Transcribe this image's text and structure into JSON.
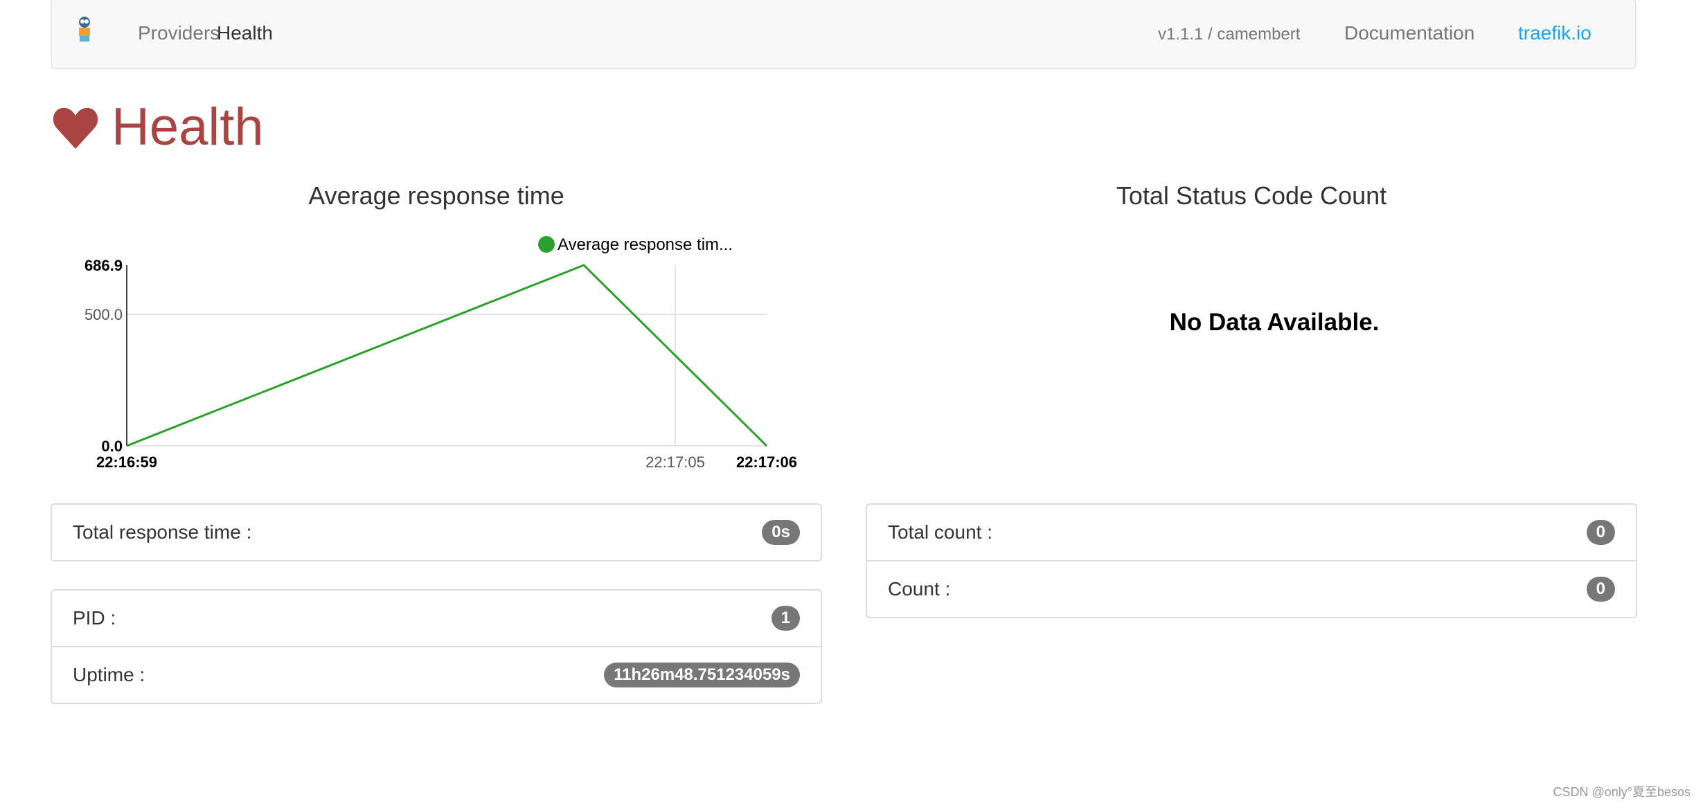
{
  "nav": {
    "logo": "traefik-gopher-logo",
    "items": [
      {
        "label": "Providers",
        "active": false
      },
      {
        "label": "Health",
        "active": true
      }
    ],
    "version": "v1.1.1 / camembert",
    "documentation": "Documentation",
    "site": "traefik.io",
    "site_color": "#1aa3e8"
  },
  "page_title": "Health",
  "title_icon": "heart-icon",
  "title_color": "#a94442",
  "response_chart": {
    "title": "Average response time"
  },
  "status_chart": {
    "title": "Total Status Code Count",
    "empty_message": "No Data Available."
  },
  "chart_data": {
    "type": "line",
    "title": "Average response time",
    "legend": {
      "entries": [
        "Average response tim..."
      ],
      "placement": "top-right"
    },
    "series": [
      {
        "name": "Average response tim...",
        "color": "#2ca02c",
        "points": [
          [
            "22:16:59",
            0
          ],
          [
            "22:17:04",
            686.9
          ],
          [
            "22:17:06",
            0
          ]
        ]
      }
    ],
    "x_ticks": [
      "22:16:59",
      "22:17:05",
      "22:17:06"
    ],
    "y_ticks": [
      "0.0",
      "500.0",
      "686.9"
    ],
    "ylim": [
      0,
      686.9
    ],
    "grid": true
  },
  "panels": {
    "response": [
      {
        "label": "Total response time :",
        "value": "0s"
      }
    ],
    "process": [
      {
        "label": "PID :",
        "value": "1"
      },
      {
        "label": "Uptime :",
        "value": "11h26m48.751234059s"
      }
    ],
    "status": [
      {
        "label": "Total count :",
        "value": "0"
      },
      {
        "label": "Count :",
        "value": "0"
      }
    ]
  },
  "watermark": "CSDN @only°夏至besos"
}
